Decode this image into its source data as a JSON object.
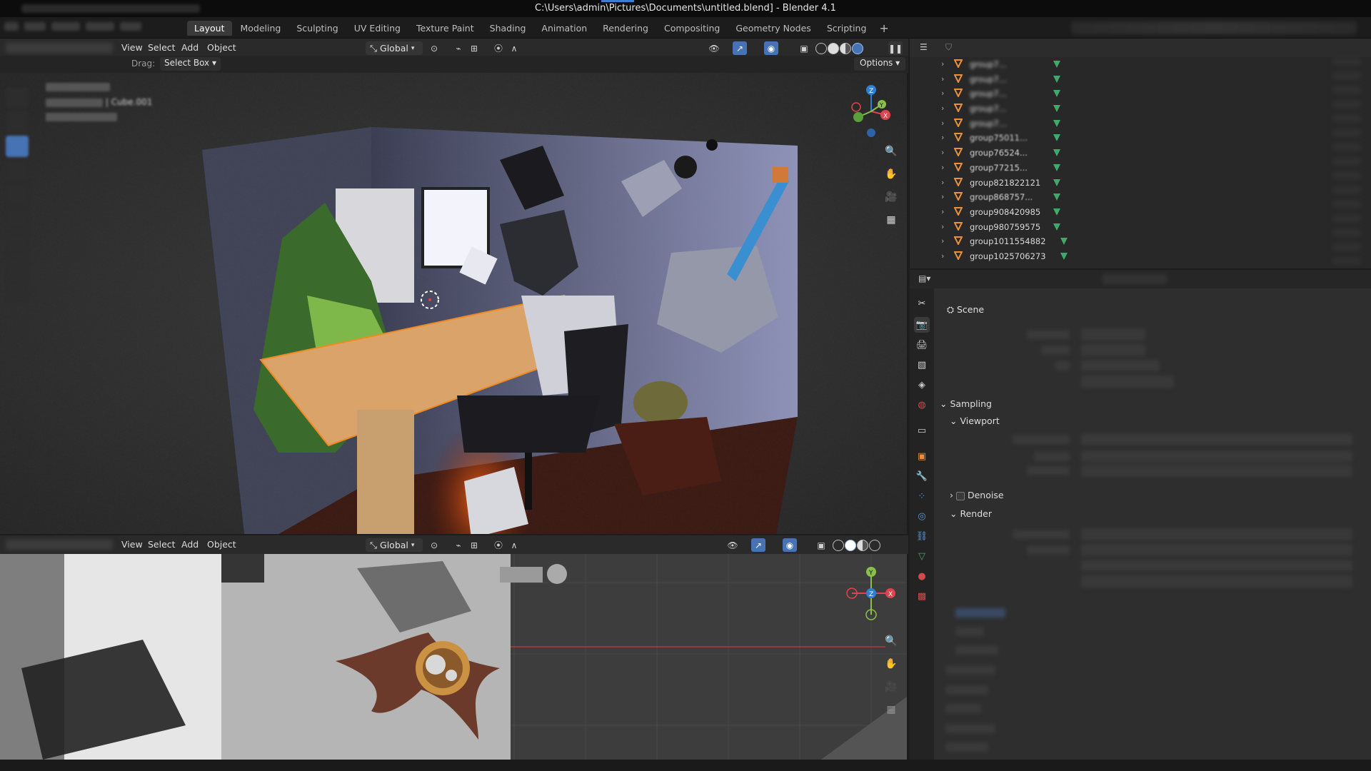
{
  "window": {
    "title": "C:\\Users\\admin\\Pictures\\Documents\\untitled.blend] - Blender 4.1"
  },
  "workspace_tabs": [
    {
      "label": "Layout",
      "active": true
    },
    {
      "label": "Modeling"
    },
    {
      "label": "Sculpting"
    },
    {
      "label": "UV Editing"
    },
    {
      "label": "Texture Paint"
    },
    {
      "label": "Shading"
    },
    {
      "label": "Animation"
    },
    {
      "label": "Rendering"
    },
    {
      "label": "Compositing"
    },
    {
      "label": "Geometry Nodes"
    },
    {
      "label": "Scripting"
    }
  ],
  "add_workspace": "+",
  "viewport_top": {
    "menus": [
      "View",
      "Select",
      "Add",
      "Object"
    ],
    "orientation": "Global",
    "drag_label": "Drag:",
    "drag_value": "Select Box",
    "options_label": "Options",
    "overlay_line2": "Cube.001"
  },
  "viewport_bottom": {
    "menus": [
      "View",
      "Select",
      "Add",
      "Object"
    ],
    "orientation": "Global"
  },
  "outliner": {
    "rows": [
      {
        "name": "group7..."
      },
      {
        "name": "group7..."
      },
      {
        "name": "group7..."
      },
      {
        "name": "group7..."
      },
      {
        "name": "group7..."
      },
      {
        "name": "group75011..."
      },
      {
        "name": "group76524..."
      },
      {
        "name": "group77215..."
      },
      {
        "name": "group821822121"
      },
      {
        "name": "group868757..."
      },
      {
        "name": "group908420985"
      },
      {
        "name": "group980759575"
      },
      {
        "name": "group1011554882"
      },
      {
        "name": "group1025706273"
      }
    ],
    "blurred_rows": 5
  },
  "properties": {
    "scene_label": "Scene",
    "sampling": "Sampling",
    "viewport": "Viewport",
    "denoise": "Denoise",
    "render": "Render"
  },
  "colors": {
    "accent": "#4772b3",
    "object_orange": "#e8913a",
    "mesh_green": "#3fa86a",
    "axis_x": "#e0434f",
    "axis_y": "#8ac04a",
    "axis_z": "#2f7fd6"
  }
}
